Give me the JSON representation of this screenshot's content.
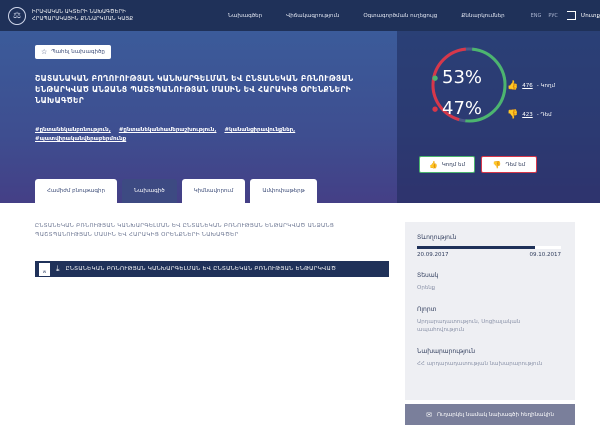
{
  "header": {
    "logo_line1": "ԻՐԱՎԱԿԱՆ ԱԿՏԵՐԻ ՆԱԽԱԳԾԵՐԻ",
    "logo_line2": "ՀՐԱՊԱՐԱԿԱՅԻՆ ՔՆՆԱՐԿՄԱՆ ԿԱՅՔ",
    "nav": [
      "Նախագծեր",
      "Վիճակագրություն",
      "Օգտագործման ուղեցույց",
      "Քննարկումներ"
    ],
    "lang_en": "ENG",
    "lang_ru": "РУС",
    "login_label": "Մուտք"
  },
  "hero": {
    "save_label": "Պահել նախագիծը",
    "title": "ՇԱՏԱՆԱԿԱՆ ԲՈՂՈՒՈՒԹՅԱՆ ԿԱՆԽԱՐԳԵԼՄԱՆ ԵՎ ԸՆՏԱՆԵԿԱՆ ԲՌՆՈՒԹՅԱՆ ԵՆԹԱՐԿՎԱԾ ԱՆՁԱՆՑ ՊԱՇՏՊԱՆՈՒԹՅԱՆ ՄԱՍԻՆ ԵՎ ՀԱՐԱԿԻՑ ՕՐԵՆՔՆԵՐԻ ՆԱԽԱԳԾԵՐ",
    "tags": [
      "#ընտանեկանբռնություն,",
      "#ընտանեկանհամերաշխություն,",
      "#կանանցիրավունքներ,",
      "#պատվիրականվերաբերմունք"
    ],
    "tabs": [
      "Համիժմ բնութագիր",
      "Նախագիծ",
      "Կիմնավորում",
      "Ամփոփաթերթ"
    ]
  },
  "votes": {
    "for_pct": "53%",
    "against_pct": "47%",
    "for_count": "476",
    "for_label": "- Կողմ",
    "against_count": "423",
    "against_label": "- Դեմ",
    "for_button": "Կողմ եմ",
    "against_button": "Դեմ եմ",
    "for_value": 53,
    "against_value": 47,
    "for_color": "#4cb56f",
    "against_color": "#d7374a"
  },
  "content": {
    "description": "ԸՆՏԱՆԵԿԱՆ ԲՌՆՈՒԹՅԱՆ ԿԱՆԽԱՐԳԵԼՄԱՆ ԵՎ ԸՆՏԱՆԵԿԱՆ ԲՌՆՈՒԹՅԱՆ ԵՆԹԱՐԿՎԱԾ ԱՆՁԱՆՑ ՊԱՇՏՊԱՆՈՒԹՅԱՆ ՄԱՍԻՆ ԵՎ ՀԱՐԱԿԻՑ ՕՐԵՆՔՆԵՐԻ ՆԱԽԱԳԾԵՐ",
    "file_type": "W",
    "file_name": "ԸՆՏԱՆԵԿԱՆ ԲՌՆՈՒԹՅԱՆ ԿԱՆԽԱՐԳԵԼՄԱՆ ԵՎ ԸՆՏԱՆԵԿԱՆ ԲՌՆՈՒԹՅԱՆ ԵՆԹԱՐԿՎԱԾ"
  },
  "sidebar": {
    "duration_label": "Տևողություն",
    "progress_fraction": 0.82,
    "start_date": "20.09.2017",
    "end_date": "09.10.2017",
    "type_label": "Տեսակ",
    "type_value": "Օրենք",
    "area_label": "Ոլորտ",
    "area_value": "Արդարադատություն, Սոցիալական ապահովություն",
    "ministry_label": "Նախարարություն",
    "ministry_value": "ՀՀ արդարադատության նախարարություն",
    "bottom_button": "Ուղարկել նամակ նախագծի հեղինակին"
  }
}
